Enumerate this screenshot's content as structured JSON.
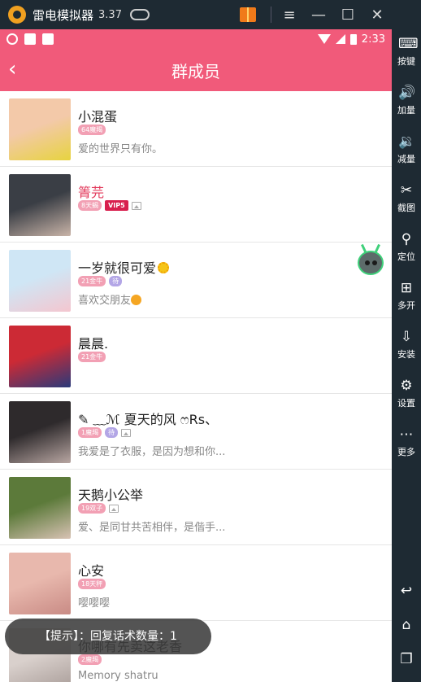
{
  "emulator": {
    "title": "雷电模拟器",
    "version": "3.37",
    "controls": [
      "≡",
      "—",
      "☐",
      "✕"
    ],
    "collapse_icon": "«"
  },
  "statusbar": {
    "time": "2:33"
  },
  "appbar": {
    "back": "‹",
    "title": "群成员"
  },
  "members": [
    {
      "name": "小混蛋",
      "badges": [
        "64魔羯"
      ],
      "purple": [],
      "vip": "",
      "pic": false,
      "signature": "爱的世界只有你。",
      "name_color": "normal",
      "avatar_colors": [
        "#f3c9a9",
        "#e7d33f"
      ]
    },
    {
      "name": "箐芫",
      "badges": [
        "8天蝎"
      ],
      "purple": [],
      "vip": "VIP5",
      "pic": true,
      "signature": "",
      "name_color": "vip",
      "avatar_colors": [
        "#3a3e45",
        "#c9b4a8"
      ]
    },
    {
      "name": "一岁就很可爱",
      "badges": [
        "21金牛"
      ],
      "purple": [
        "待"
      ],
      "vip": "",
      "pic": false,
      "signature": "喜欢交朋友",
      "name_color": "normal",
      "avatar_colors": [
        "#cfe6f5",
        "#f4c6cf"
      ]
    },
    {
      "name": "晨晨.",
      "badges": [
        "21金牛"
      ],
      "purple": [],
      "vip": "",
      "pic": false,
      "signature": "",
      "name_color": "normal",
      "avatar_colors": [
        "#cc2a35",
        "#2a3a7a"
      ]
    },
    {
      "name": "✎ ﹏ℳ 夏天的风 ෆRs、",
      "badges": [
        "1魔羯"
      ],
      "purple": [
        "待"
      ],
      "vip": "",
      "pic": true,
      "signature": "我爱是了衣服，是因为想和你...",
      "name_color": "normal",
      "avatar_colors": [
        "#2e2a2c",
        "#b8a6a2"
      ]
    },
    {
      "name": "天鹅小公举",
      "badges": [
        "19双子"
      ],
      "purple": [],
      "vip": "",
      "pic": true,
      "signature": "爱、是同甘共苦相伴，是偕手...",
      "name_color": "normal",
      "avatar_colors": [
        "#5c7a3a",
        "#d8c2b4"
      ]
    },
    {
      "name": "心安",
      "badges": [
        "18天秤"
      ],
      "purple": [],
      "vip": "",
      "pic": false,
      "signature": "嘤嘤嘤",
      "name_color": "normal",
      "avatar_colors": [
        "#e8b8ad",
        "#c98b85"
      ]
    },
    {
      "name": "你哪有先卖这老香",
      "badges": [
        "2魔羯"
      ],
      "purple": [],
      "vip": "",
      "pic": false,
      "signature": "Memory shatru",
      "name_color": "normal",
      "avatar_colors": [
        "#d9d0cc",
        "#a89c98"
      ]
    }
  ],
  "toast": {
    "text": "【提示】：回复话术数量：1"
  },
  "sidebar": [
    {
      "icon": "keyboard-icon",
      "glyph": "⌨",
      "label": "按键"
    },
    {
      "icon": "volume-up-icon",
      "glyph": "🔊",
      "label": "加量"
    },
    {
      "icon": "volume-down-icon",
      "glyph": "🔉",
      "label": "减量"
    },
    {
      "icon": "scissors-icon",
      "glyph": "✂",
      "label": "截图"
    },
    {
      "icon": "location-icon",
      "glyph": "⚲",
      "label": "定位"
    },
    {
      "icon": "multi-open-icon",
      "glyph": "⊞",
      "label": "多开"
    },
    {
      "icon": "apk-install-icon",
      "glyph": "⇩",
      "label": "安装"
    },
    {
      "icon": "gear-icon",
      "glyph": "⚙",
      "label": "设置"
    },
    {
      "icon": "more-icon",
      "glyph": "⋯",
      "label": "更多"
    }
  ],
  "nav": [
    {
      "icon": "back-nav-icon",
      "glyph": "↩"
    },
    {
      "icon": "home-nav-icon",
      "glyph": "⌂"
    },
    {
      "icon": "recents-nav-icon",
      "glyph": "❐"
    }
  ]
}
